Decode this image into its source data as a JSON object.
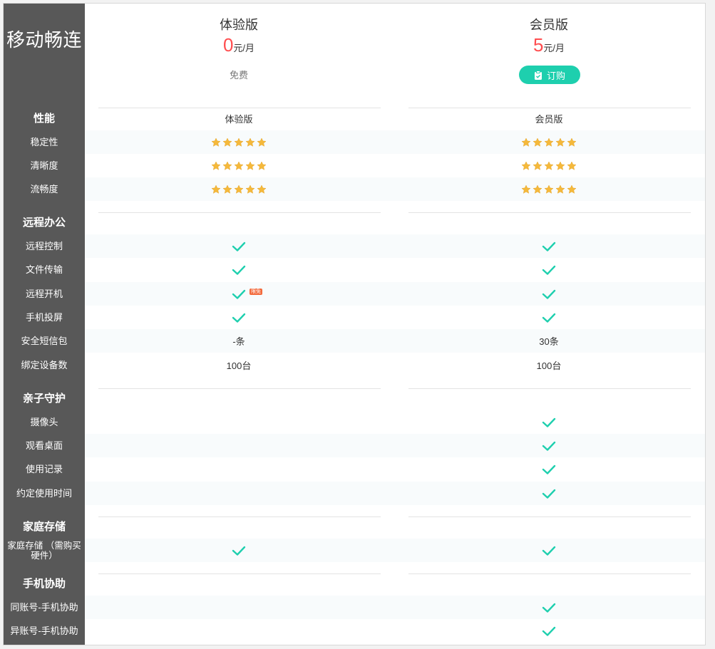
{
  "brand": "移动畅连",
  "plans": {
    "trial": {
      "name": "体验版",
      "price": "0",
      "unit": "元/月",
      "action": "免费"
    },
    "member": {
      "name": "会员版",
      "price": "5",
      "unit": "元/月",
      "action": "订购"
    }
  },
  "sections": {
    "performance": {
      "label": "性能",
      "header_trial": "体验版",
      "header_member": "会员版",
      "rows": [
        {
          "label": "稳定性",
          "trial_stars": 5,
          "member_stars": 5
        },
        {
          "label": "清晰度",
          "trial_stars": 5,
          "member_stars": 5
        },
        {
          "label": "流畅度",
          "trial_stars": 5,
          "member_stars": 5
        }
      ]
    },
    "remote_office": {
      "label": "远程办公",
      "rows": [
        {
          "label": "远程控制",
          "trial": "check",
          "member": "check"
        },
        {
          "label": "文件传输",
          "trial": "check",
          "member": "check"
        },
        {
          "label": "远程开机",
          "trial": "check",
          "member": "check",
          "trial_badge": "限免"
        },
        {
          "label": "手机投屏",
          "trial": "check",
          "member": "check"
        },
        {
          "label": "安全短信包",
          "trial": "-条",
          "member": "30条"
        },
        {
          "label": "绑定设备数",
          "trial": "100台",
          "member": "100台"
        }
      ]
    },
    "parental": {
      "label": "亲子守护",
      "rows": [
        {
          "label": "摄像头",
          "trial": "",
          "member": "check"
        },
        {
          "label": "观看桌面",
          "trial": "",
          "member": "check"
        },
        {
          "label": "使用记录",
          "trial": "",
          "member": "check"
        },
        {
          "label": "约定使用时间",
          "trial": "",
          "member": "check"
        }
      ]
    },
    "home_storage": {
      "label": "家庭存储",
      "rows": [
        {
          "label": "家庭存储 （需购买硬件）",
          "trial": "check",
          "member": "check"
        }
      ]
    },
    "phone_assist": {
      "label": "手机协助",
      "rows": [
        {
          "label": "同账号-手机协助",
          "trial": "",
          "member": "check"
        },
        {
          "label": "异账号-手机协助",
          "trial": "",
          "member": "check"
        }
      ]
    }
  },
  "colors": {
    "sidebar": "#585858",
    "accent": "#1ecfae",
    "price": "#ff4d4f",
    "star": "#f5b93b"
  }
}
